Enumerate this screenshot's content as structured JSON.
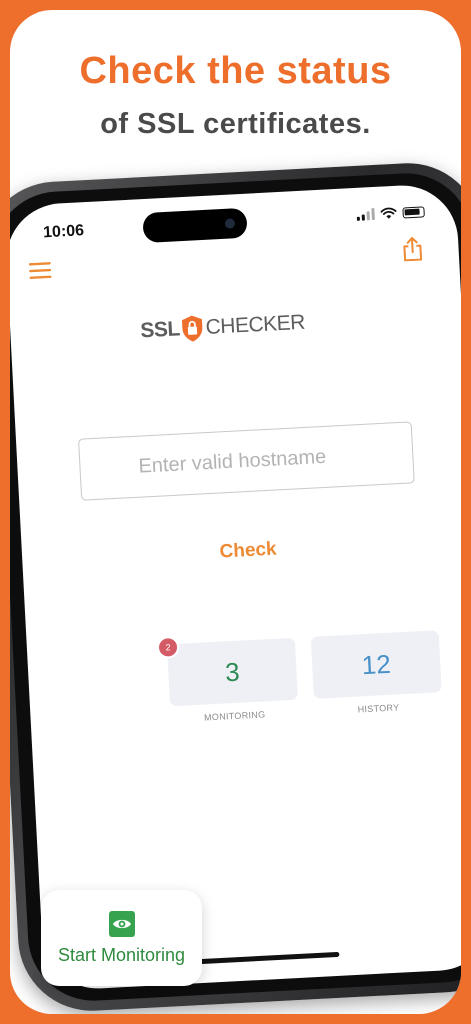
{
  "headline": "Check the status",
  "subline": "of SSL certificates.",
  "status_bar": {
    "time": "10:06"
  },
  "logo": {
    "left": "SSL",
    "right": "CHECKER"
  },
  "hostname_input": {
    "placeholder": "Enter valid hostname",
    "value": ""
  },
  "check_button": {
    "label": "Check"
  },
  "stats": {
    "monitoring": {
      "value": "3",
      "label": "MONITORING",
      "badge": "2"
    },
    "history": {
      "value": "12",
      "label": "HISTORY"
    }
  },
  "start_monitoring": {
    "label": "Start Monitoring"
  },
  "colors": {
    "brand_orange": "#ee6e2c",
    "check_orange": "#ee8a33",
    "monitoring_green": "#2e8b57",
    "history_blue": "#4a90c8",
    "badge_red": "#d45a66",
    "start_green": "#37a34f"
  },
  "icons": {
    "menu": "hamburger-menu-icon",
    "share": "share-icon",
    "logo_shield": "shield-lock-icon",
    "start": "eye-icon"
  }
}
